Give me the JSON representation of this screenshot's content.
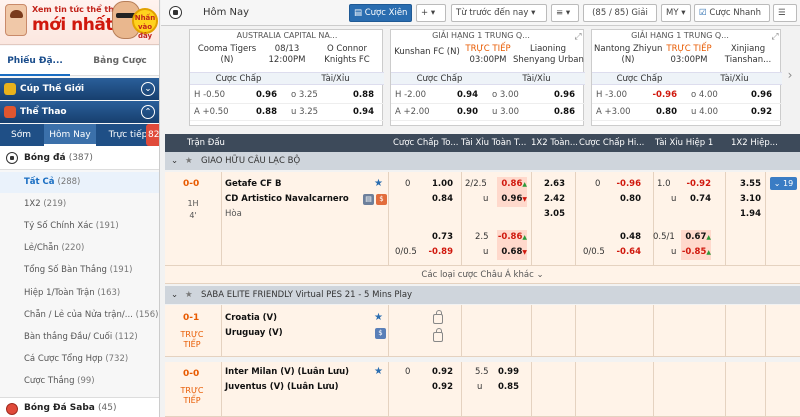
{
  "banner": {
    "line1": "Xem tin tức thể thao",
    "line2": "mới nhất",
    "stamp": "Nhấn vào đây"
  },
  "sidebar": {
    "tab_active": "Phiếu Đặ...",
    "tab_other": "Bảng Cược",
    "cat_world": "Cúp Thế Giới",
    "cat_sport": "Thể Thao",
    "subtabs": [
      "Sớm",
      "Hôm Nay",
      "Trực tiếp"
    ],
    "live_count": "82",
    "sport": {
      "name": "Bóng đá",
      "count": "(387)"
    },
    "menu": [
      {
        "label": "Tất Cả",
        "count": "(288)"
      },
      {
        "label": "1X2",
        "count": "(219)"
      },
      {
        "label": "Tỷ Số Chính Xác",
        "count": "(191)"
      },
      {
        "label": "Lẻ/Chẵn",
        "count": "(220)"
      },
      {
        "label": "Tổng Số Bàn Thắng",
        "count": "(191)"
      },
      {
        "label": "Hiệp 1/Toàn Trận",
        "count": "(163)"
      },
      {
        "label": "Chẵn / Lẻ của Nửa trận/...",
        "count": "(156)"
      },
      {
        "label": "Bàn thắng Đầu/ Cuối",
        "count": "(112)"
      },
      {
        "label": "Cá Cược Tổng Hợp",
        "count": "(732)"
      },
      {
        "label": "Cược Thắng",
        "count": "(99)"
      }
    ],
    "saba": {
      "name": "Bóng Đá Saba",
      "count": "(45)"
    }
  },
  "topbar": {
    "title": "Hôm Nay",
    "parlay": "Cược Xiên",
    "add": "+",
    "sort": "Từ trước đến nay",
    "list": "≡",
    "count": "(85 / 85) Giải",
    "market": "MY",
    "quick": "Cược Nhanh"
  },
  "cards": [
    {
      "league": "AUSTRALIA CAPITAL NA...",
      "home": "Cooma Tigers",
      "home2": "(N)",
      "time1": "08/13",
      "time2": "12:00PM",
      "away": "O Connor",
      "away2": "Knights FC",
      "h1": "H -0.50",
      "h1v": "0.96",
      "o1": "o 3.25",
      "o1v": "0.88",
      "h2": "A +0.50",
      "h2v": "0.88",
      "o2": "u 3.25",
      "o2v": "0.94"
    },
    {
      "league": "GIẢI HẠNG 1 TRUNG Q...",
      "home": "Kunshan FC (N)",
      "home2": "",
      "time1": "TRỰC TIẾP",
      "time2": "03:00PM",
      "away": "Liaoning",
      "away2": "Shenyang Urban",
      "h1": "H -2.00",
      "h1v": "0.94",
      "o1": "o 3.00",
      "o1v": "0.96",
      "h2": "A +2.00",
      "h2v": "0.90",
      "o2": "u 3.00",
      "o2v": "0.86"
    },
    {
      "league": "GIẢI HẠNG 1 TRUNG Q...",
      "home": "Nantong Zhiyun",
      "home2": "(N)",
      "time1": "TRỰC TIẾP",
      "time2": "03:00PM",
      "away": "Xinjiang",
      "away2": "Tianshan...",
      "h1": "H -3.00",
      "h1v": "-0.96",
      "o1": "o 4.00",
      "o1v": "0.96",
      "h2": "A +3.00",
      "h2v": "0.80",
      "o2": "u 4.00",
      "o2v": "0.92"
    }
  ],
  "card_headers": {
    "hdp": "Cược Chấp",
    "ou": "Tài/Xỉu"
  },
  "grid_header": [
    "Trận Đấu",
    "Cược Chấp To...",
    "Tài Xỉu Toàn T...",
    "1X2 Toàn...",
    "Cược Chấp Hi...",
    "Tài Xỉu Hiệp 1",
    "1X2 Hiệp..."
  ],
  "league1": "GIAO HỮU CÂU LẠC BỘ",
  "m1": {
    "score": "0-0",
    "half": "1H",
    "minute": "4'",
    "home": "Getafe CF B",
    "away": "CD Artistico Navalcarnero",
    "draw": "Hòa",
    "r1": {
      "hdp_line": "0",
      "hdp_o": "1.00",
      "ou_line": "2/2.5",
      "ou_o": "0.86",
      "x1": "2.63",
      "h_line": "0",
      "h_o": "-0.96",
      "hou_line": "1.0",
      "hou_o": "-0.92",
      "hx1": "3.55"
    },
    "r2": {
      "hdp_o": "0.84",
      "ou_lbl": "u",
      "ou_o": "0.96",
      "x1": "2.42",
      "h_o": "0.80",
      "hou_lbl": "u",
      "hou_o": "0.74",
      "hx1": "3.10"
    },
    "r3": {
      "x1": "3.05",
      "hx1": "1.94"
    },
    "r4": {
      "hdp_o": "0.73",
      "ou_line": "2.5",
      "ou_o": "-0.86",
      "h_o": "0.48",
      "hou_line": "0.5/1",
      "hou_o": "0.67"
    },
    "r5": {
      "hdp_line": "0/0.5",
      "hdp_o": "-0.89",
      "ou_lbl": "u",
      "ou_o": "0.68",
      "h_line": "0/0.5",
      "h_o": "-0.64",
      "hou_lbl": "u",
      "hou_o": "-0.85"
    },
    "more": "Các loại cược Châu Á khác"
  },
  "side_badge": "19",
  "league2": "SABA ELITE FRIENDLY Virtual PES 21 - 5 Mins Play",
  "m2": {
    "score": "0-1",
    "state1": "TRỰC",
    "state2": "TIẾP",
    "home": "Croatia (V)",
    "away": "Uruguay (V)"
  },
  "m3": {
    "score": "0-0",
    "state1": "TRỰC",
    "state2": "TIẾP",
    "home": "Inter Milan (V) (Luân Lưu)",
    "away": "Juventus (V) (Luân Lưu)",
    "r1": {
      "hdp_line": "0",
      "hdp_o": "0.92",
      "ou_line": "5.5",
      "ou_o": "0.99"
    },
    "r2": {
      "hdp_o": "0.92",
      "ou_lbl": "u",
      "ou_o": "0.85"
    }
  }
}
